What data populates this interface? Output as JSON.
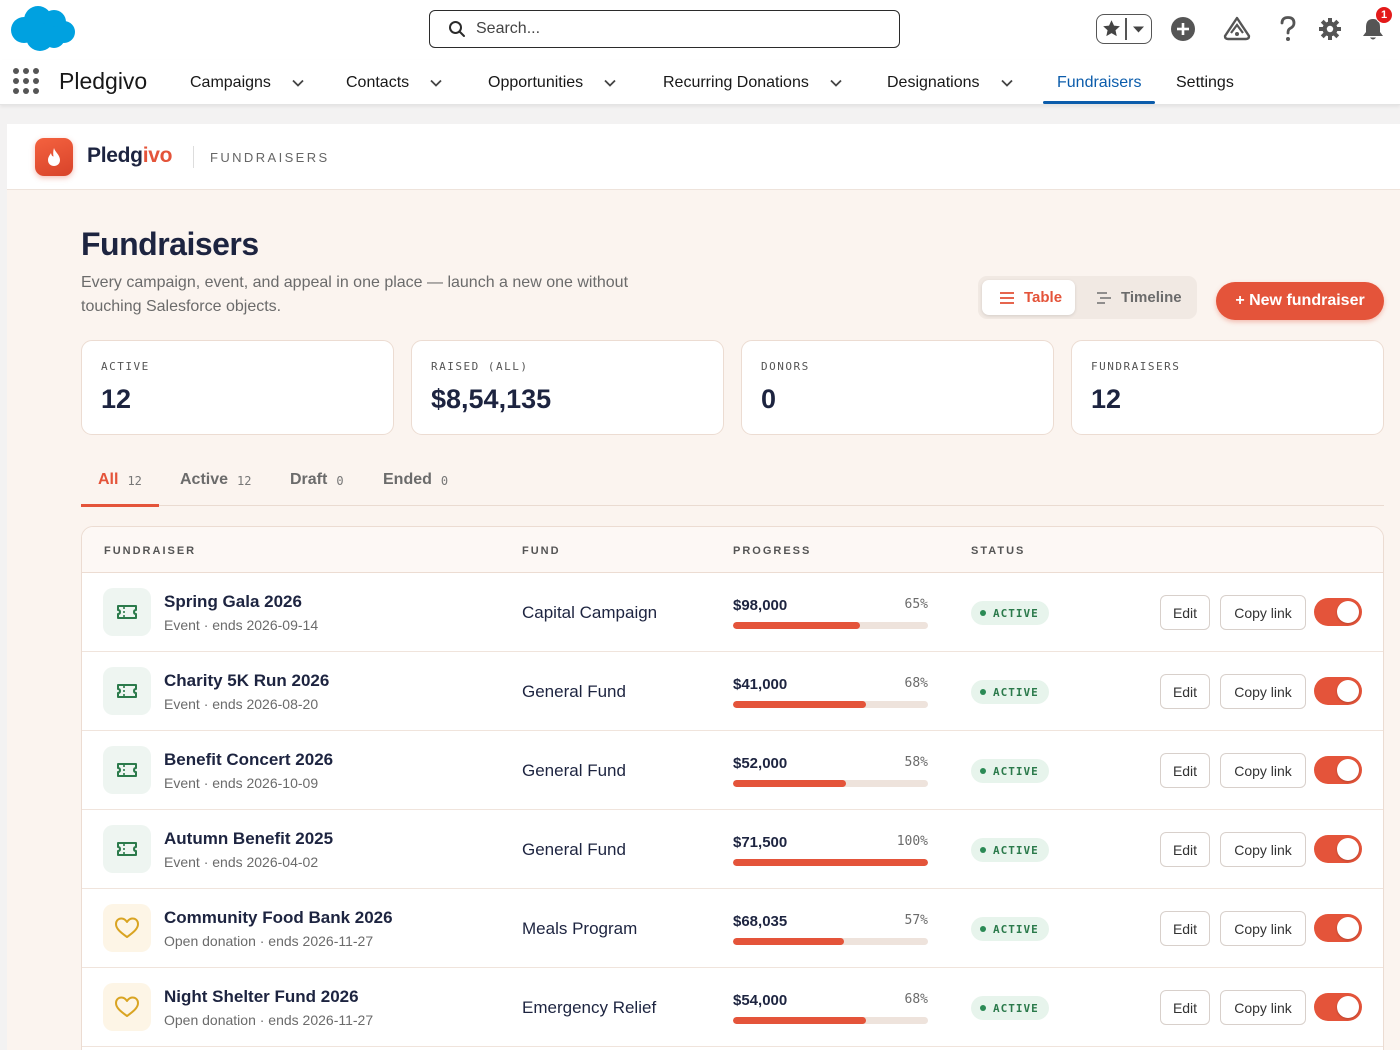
{
  "global_header": {
    "search_placeholder": "Search...",
    "notification_count": "1"
  },
  "nav": {
    "app_name": "Pledgivo",
    "items": [
      {
        "label": "Campaigns",
        "dropdown": true
      },
      {
        "label": "Contacts",
        "dropdown": true
      },
      {
        "label": "Opportunities",
        "dropdown": true
      },
      {
        "label": "Recurring Donations",
        "dropdown": true
      },
      {
        "label": "Designations",
        "dropdown": true
      },
      {
        "label": "Fundraisers",
        "dropdown": false,
        "active": true
      },
      {
        "label": "Settings",
        "dropdown": false
      }
    ]
  },
  "brand": {
    "name_prefix": "Pledg",
    "name_accent": "ivo",
    "section": "FUNDRAISERS"
  },
  "page": {
    "title": "Fundraisers",
    "subtitle": "Every campaign, event, and appeal in one place — launch a new one without touching Salesforce objects.",
    "view_toggle": {
      "table": "Table",
      "timeline": "Timeline",
      "selected": "Table"
    },
    "new_button": "+ New fundraiser"
  },
  "stats": [
    {
      "label": "ACTIVE",
      "value": "12"
    },
    {
      "label": "RAISED (ALL)",
      "value": "$8,54,135"
    },
    {
      "label": "DONORS",
      "value": "0"
    },
    {
      "label": "FUNDRAISERS",
      "value": "12"
    }
  ],
  "filters": [
    {
      "label": "All",
      "count": "12",
      "active": true
    },
    {
      "label": "Active",
      "count": "12"
    },
    {
      "label": "Draft",
      "count": "0"
    },
    {
      "label": "Ended",
      "count": "0"
    }
  ],
  "table": {
    "headers": {
      "fundraiser": "FUNDRAISER",
      "fund": "FUND",
      "progress": "PROGRESS",
      "status": "STATUS"
    },
    "edit_label": "Edit",
    "copy_label": "Copy link",
    "rows": [
      {
        "icon": "ticket-icon",
        "type": "event",
        "name": "Spring Gala 2026",
        "meta": "Event · ends 2026-09-14",
        "fund": "Capital Campaign",
        "amount": "$98,000",
        "percent": 65,
        "percent_label": "65%",
        "status": "ACTIVE",
        "enabled": true
      },
      {
        "icon": "ticket-icon",
        "type": "event",
        "name": "Charity 5K Run 2026",
        "meta": "Event · ends 2026-08-20",
        "fund": "General Fund",
        "amount": "$41,000",
        "percent": 68,
        "percent_label": "68%",
        "status": "ACTIVE",
        "enabled": true
      },
      {
        "icon": "ticket-icon",
        "type": "event",
        "name": "Benefit Concert 2026",
        "meta": "Event · ends 2026-10-09",
        "fund": "General Fund",
        "amount": "$52,000",
        "percent": 58,
        "percent_label": "58%",
        "status": "ACTIVE",
        "enabled": true
      },
      {
        "icon": "ticket-icon",
        "type": "event",
        "name": "Autumn Benefit 2025",
        "meta": "Event · ends 2026-04-02",
        "fund": "General Fund",
        "amount": "$71,500",
        "percent": 100,
        "percent_label": "100%",
        "status": "ACTIVE",
        "enabled": true
      },
      {
        "icon": "heart-icon",
        "type": "donation",
        "name": "Community Food Bank 2026",
        "meta": "Open donation · ends 2026-11-27",
        "fund": "Meals Program",
        "amount": "$68,035",
        "percent": 57,
        "percent_label": "57%",
        "status": "ACTIVE",
        "enabled": true
      },
      {
        "icon": "heart-icon",
        "type": "donation",
        "name": "Night Shelter Fund 2026",
        "meta": "Open donation · ends 2026-11-27",
        "fund": "Emergency Relief",
        "amount": "$54,000",
        "percent": 68,
        "percent_label": "68%",
        "status": "ACTIVE",
        "enabled": true
      }
    ]
  },
  "colors": {
    "accent": "#e4543a",
    "navy": "#1d2440",
    "salesforce_blue": "#0b5cab",
    "active_green": "#2b7a4b",
    "canvas": "#fbf4ef"
  }
}
